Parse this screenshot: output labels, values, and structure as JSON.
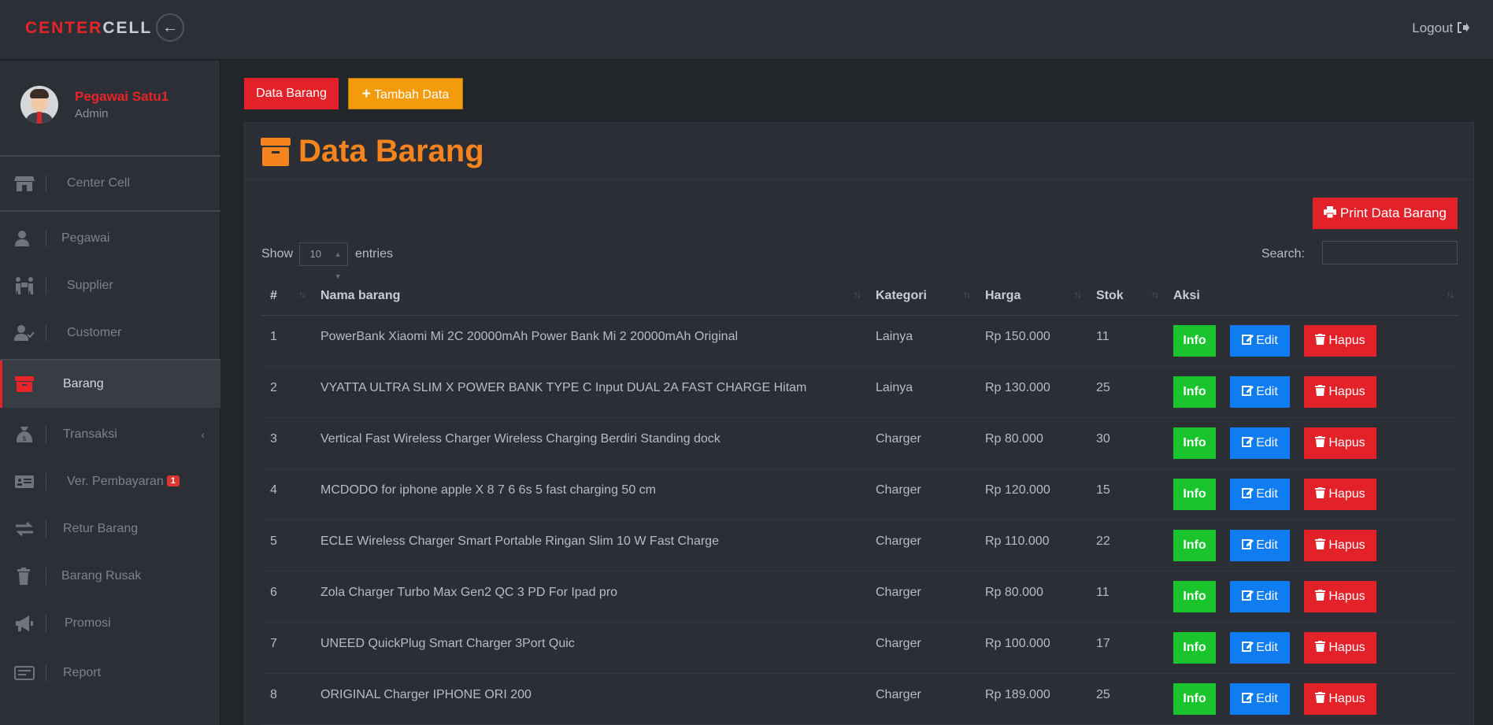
{
  "brand": {
    "part1": "CENTER",
    "part2": "CELL"
  },
  "header": {
    "toggle_icon": "arrow-left-icon",
    "logout_label": "Logout"
  },
  "profile": {
    "name": "Pegawai Satu1",
    "role": "Admin"
  },
  "sidebar": {
    "items": [
      {
        "label": "Center Cell",
        "icon": "store-icon"
      },
      {
        "label": "Pegawai",
        "icon": "user-icon"
      },
      {
        "label": "Supplier",
        "icon": "people-carry-icon"
      },
      {
        "label": "Customer",
        "icon": "user-check-icon"
      },
      {
        "label": "Barang",
        "icon": "archive-icon"
      },
      {
        "label": "Transaksi",
        "icon": "money-bag-icon"
      },
      {
        "label": "Ver. Pembayaran",
        "icon": "id-card-icon",
        "badge": "1"
      },
      {
        "label": "Retur Barang",
        "icon": "exchange-icon"
      },
      {
        "label": "Barang Rusak",
        "icon": "trash-icon"
      },
      {
        "label": "Promosi",
        "icon": "bullhorn-icon"
      },
      {
        "label": "Report",
        "icon": "report-icon"
      }
    ],
    "active": "Barang"
  },
  "main": {
    "breadcrumb_button": "Data Barang",
    "add_button": "Tambah Data",
    "title": "Data Barang",
    "print_button": "Print Data Barang",
    "show_label": "Show",
    "entries_value": "10",
    "entries_label": "entries",
    "search_label": "Search:",
    "search_value": ""
  },
  "table": {
    "columns": [
      "#",
      "Nama barang",
      "Kategori",
      "Harga",
      "Stok",
      "Aksi"
    ],
    "action_labels": {
      "info": "Info",
      "edit": "Edit",
      "delete": "Hapus"
    },
    "rows": [
      {
        "no": "1",
        "nama": "PowerBank Xiaomi Mi 2C 20000mAh Power Bank Mi 2 20000mAh Original",
        "kategori": "Lainya",
        "harga": "Rp 150.000",
        "stok": "11"
      },
      {
        "no": "2",
        "nama": "VYATTA ULTRA SLIM X POWER BANK TYPE C Input DUAL 2A FAST CHARGE Hitam",
        "kategori": "Lainya",
        "harga": "Rp 130.000",
        "stok": "25"
      },
      {
        "no": "3",
        "nama": "Vertical Fast Wireless Charger Wireless Charging Berdiri Standing dock",
        "kategori": "Charger",
        "harga": "Rp 80.000",
        "stok": "30"
      },
      {
        "no": "4",
        "nama": "MCDODO for iphone apple X 8 7 6 6s 5 fast charging 50 cm",
        "kategori": "Charger",
        "harga": "Rp 120.000",
        "stok": "15"
      },
      {
        "no": "5",
        "nama": "ECLE Wireless Charger Smart Portable Ringan Slim 10 W Fast Charge",
        "kategori": "Charger",
        "harga": "Rp 110.000",
        "stok": "22"
      },
      {
        "no": "6",
        "nama": "Zola Charger Turbo Max Gen2 QC 3 PD For Ipad pro",
        "kategori": "Charger",
        "harga": "Rp 80.000",
        "stok": "11"
      },
      {
        "no": "7",
        "nama": "UNEED QuickPlug Smart Charger 3Port Quic",
        "kategori": "Charger",
        "harga": "Rp 100.000",
        "stok": "17"
      },
      {
        "no": "8",
        "nama": "ORIGINAL Charger IPHONE ORI 200",
        "kategori": "Charger",
        "harga": "Rp 189.000",
        "stok": "25"
      }
    ]
  },
  "colors": {
    "accent": "#e8232a",
    "title": "#f5841f",
    "info": "#19c42c",
    "edit": "#0f7cf1",
    "delete": "#e32128",
    "add": "#f49b0b"
  }
}
